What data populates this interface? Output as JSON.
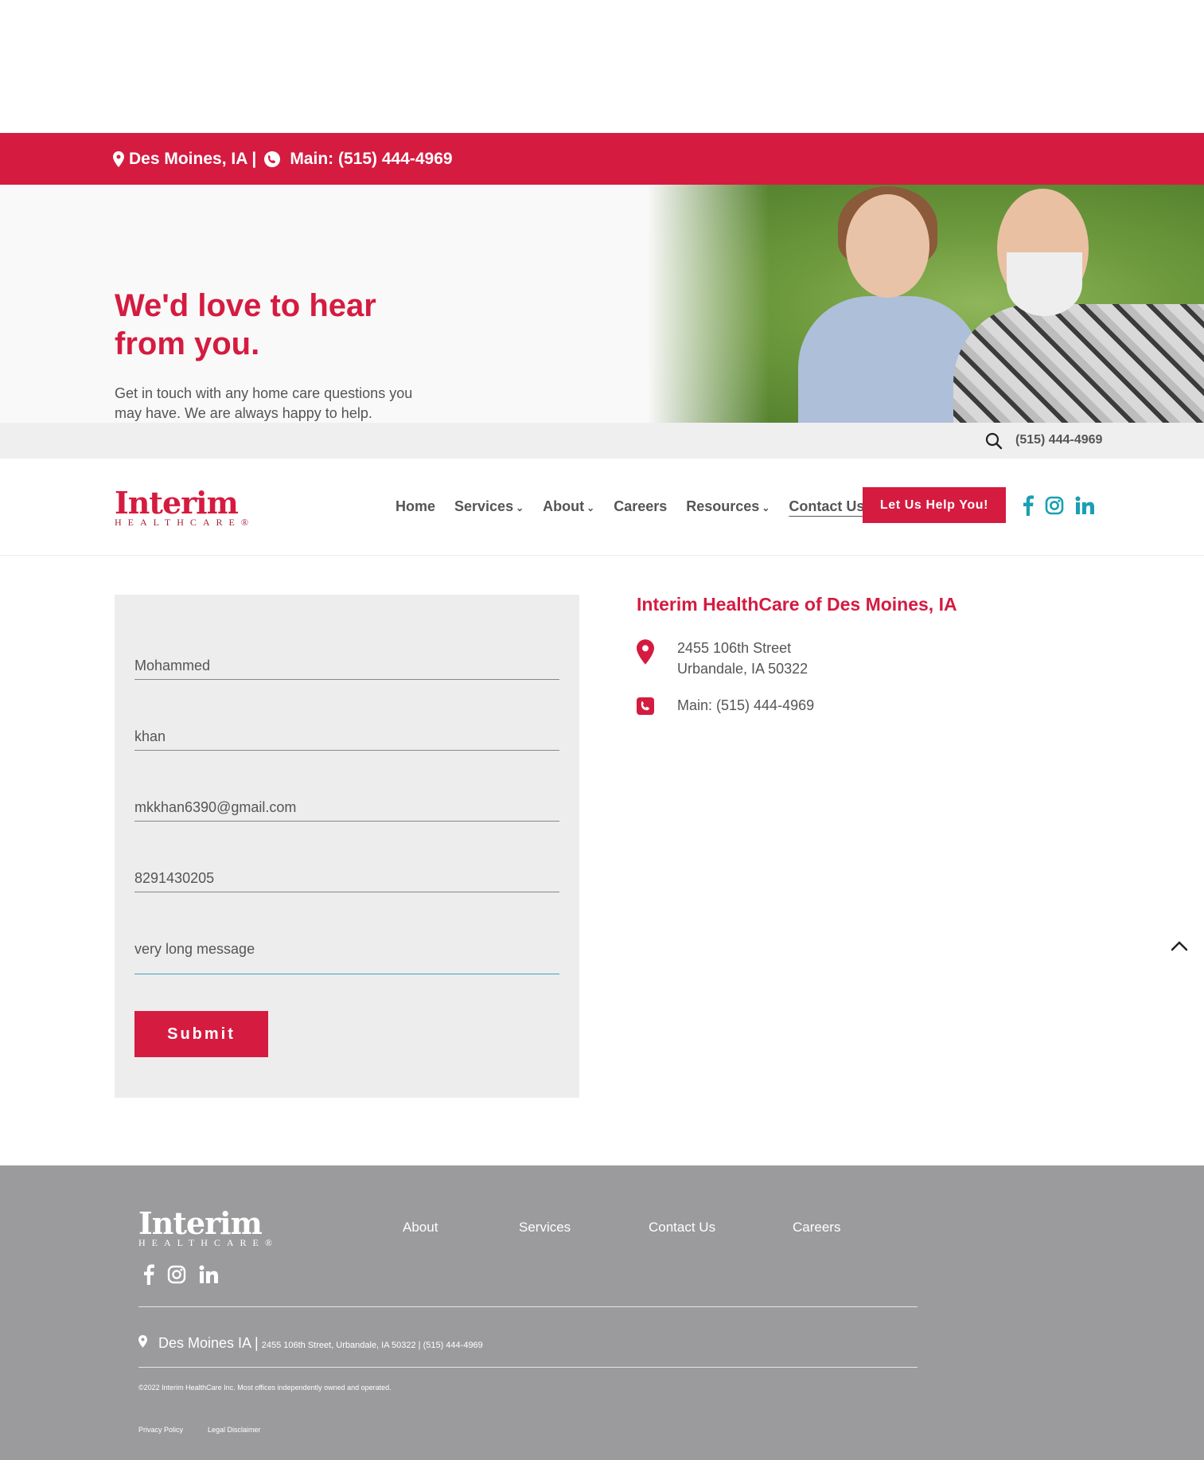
{
  "topbar": {
    "location": "Des Moines, IA |",
    "phone": "Main: (515) 444-4969"
  },
  "hero": {
    "title": "We'd love to hear from you.",
    "subtitle": "Get in touch with any home care questions you may have. We are always happy to help."
  },
  "utility": {
    "phone": "(515) 444-4969"
  },
  "logo": {
    "word": "Interim",
    "tagline": "HEALTHCARE®"
  },
  "nav": {
    "items": [
      {
        "label": "Home",
        "caret": false
      },
      {
        "label": "Services",
        "caret": true
      },
      {
        "label": "About",
        "caret": true
      },
      {
        "label": "Careers",
        "caret": false
      },
      {
        "label": "Resources",
        "caret": true
      },
      {
        "label": "Contact Us",
        "caret": false
      }
    ],
    "cta": "Let Us Help You!"
  },
  "form": {
    "first_name": "Mohammed",
    "last_name": "khan",
    "email": "mkkhan6390@gmail.com",
    "phone": "8291430205",
    "message": "very long message",
    "submit": "Submit"
  },
  "office": {
    "title": "Interim HealthCare of Des Moines, IA",
    "address_line1": "2455 106th Street",
    "address_line2": "Urbandale, IA 50322",
    "phone": "Main: (515) 444-4969"
  },
  "footer": {
    "links": [
      "About",
      "Services",
      "Contact Us",
      "Careers"
    ],
    "city": "Des Moines IA |",
    "full_address": "2455 106th Street, Urbandale, IA 50322 | (515) 444-4969",
    "copyright": "©2022 Interim HealthCare Inc. Most offices independently owned and operated.",
    "legal": [
      "Privacy Policy",
      "Legal Disclaimer"
    ]
  },
  "colors": {
    "brand_red": "#d51b40",
    "social_teal": "#1a9fb3",
    "footer_gray": "#9b9b9d"
  },
  "icons": [
    "map-pin-icon",
    "phone-icon",
    "search-icon",
    "facebook-icon",
    "instagram-icon",
    "linkedin-icon",
    "chevron-up-icon"
  ]
}
